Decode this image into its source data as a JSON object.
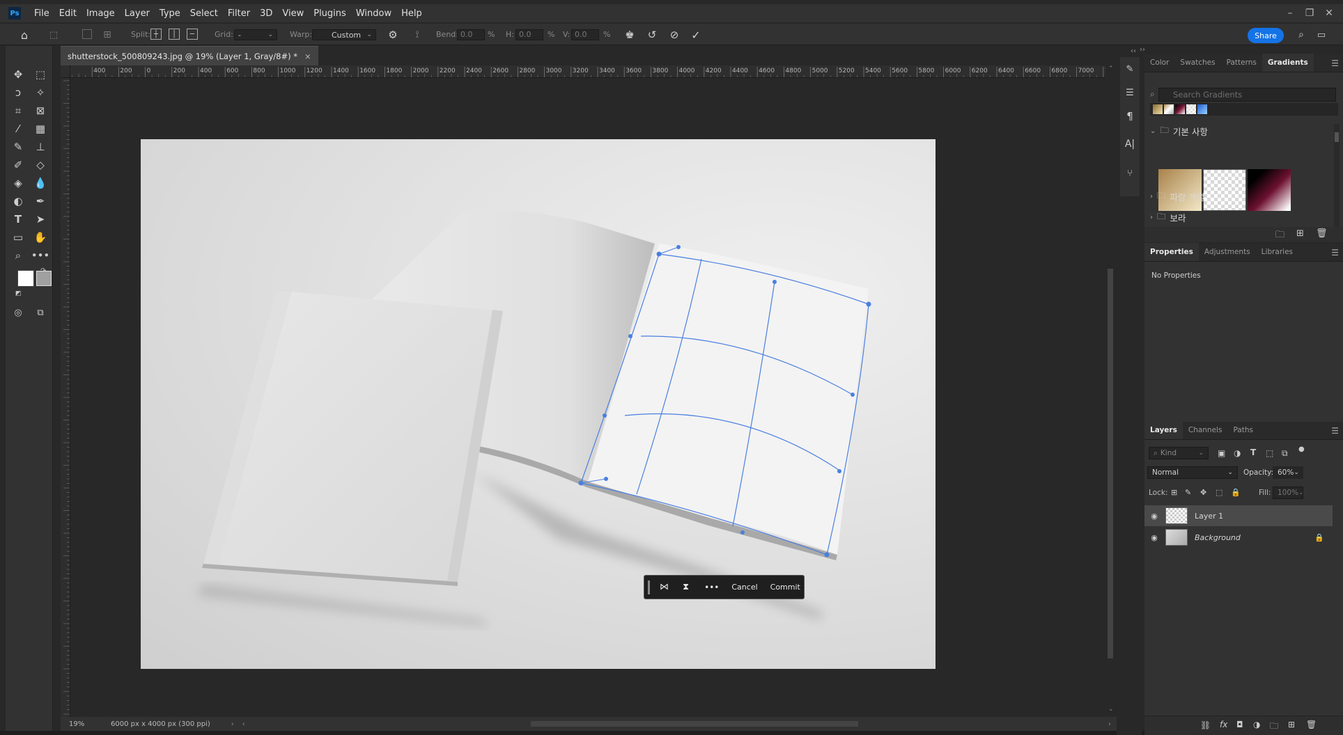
{
  "app": {
    "logo": "Ps"
  },
  "menu": [
    "File",
    "Edit",
    "Image",
    "Layer",
    "Type",
    "Select",
    "Filter",
    "3D",
    "View",
    "Plugins",
    "Window",
    "Help"
  ],
  "window_controls": {
    "minimize": "–",
    "restore": "❐",
    "close": "✕"
  },
  "options": {
    "split_label": "Split:",
    "grid_label": "Grid:",
    "grid_value": "-",
    "warp_label": "Warp:",
    "warp_value": "Custom",
    "bend_label": "Bend:",
    "bend_value": "0.0",
    "h_label": "H:",
    "h_value": "0.0",
    "v_label": "V:",
    "v_value": "0.0",
    "pct": "%",
    "share": "Share"
  },
  "document": {
    "tab_title": "shutterstock_500809243.jpg @ 19% (Layer 1, Gray/8#) *",
    "zoom": "19%",
    "size_info": "6000 px x 4000 px (300 ppi)"
  },
  "ruler_labels": [
    "0",
    "400",
    "200",
    "0",
    "200",
    "400",
    "600",
    "800",
    "1000",
    "1200",
    "1400",
    "1600",
    "1800",
    "2000",
    "2200",
    "2400",
    "2600",
    "2800",
    "3000",
    "3200",
    "3400",
    "3600",
    "3800",
    "4000",
    "4200",
    "4400",
    "4600",
    "4800",
    "5000",
    "5200",
    "5400",
    "5600",
    "5800",
    "6000",
    "6200",
    "6400",
    "6600",
    "6800",
    "7000",
    "720"
  ],
  "context_bar": {
    "cancel": "Cancel",
    "commit": "Commit"
  },
  "gradients_panel": {
    "tabs": [
      "Color",
      "Swatches",
      "Patterns",
      "Gradients"
    ],
    "active_tab": "Gradients",
    "search_placeholder": "Search Gradients",
    "folders": [
      "기본 사항",
      "파랑 계열",
      "보라"
    ]
  },
  "properties_panel": {
    "tabs": [
      "Properties",
      "Adjustments",
      "Libraries"
    ],
    "active_tab": "Properties",
    "message": "No Properties"
  },
  "layers_panel": {
    "tabs": [
      "Layers",
      "Channels",
      "Paths"
    ],
    "active_tab": "Layers",
    "kind_label": "Kind",
    "blend_mode": "Normal",
    "opacity_label": "Opacity:",
    "opacity_value": "60%",
    "lock_label": "Lock:",
    "fill_label": "Fill:",
    "fill_value": "100%",
    "layers": [
      {
        "name": "Layer 1",
        "selected": true
      },
      {
        "name": "Background",
        "selected": false,
        "locked": true
      }
    ]
  },
  "colors": {
    "accent": "#1473e6",
    "warp_line": "#4a7fe0"
  }
}
